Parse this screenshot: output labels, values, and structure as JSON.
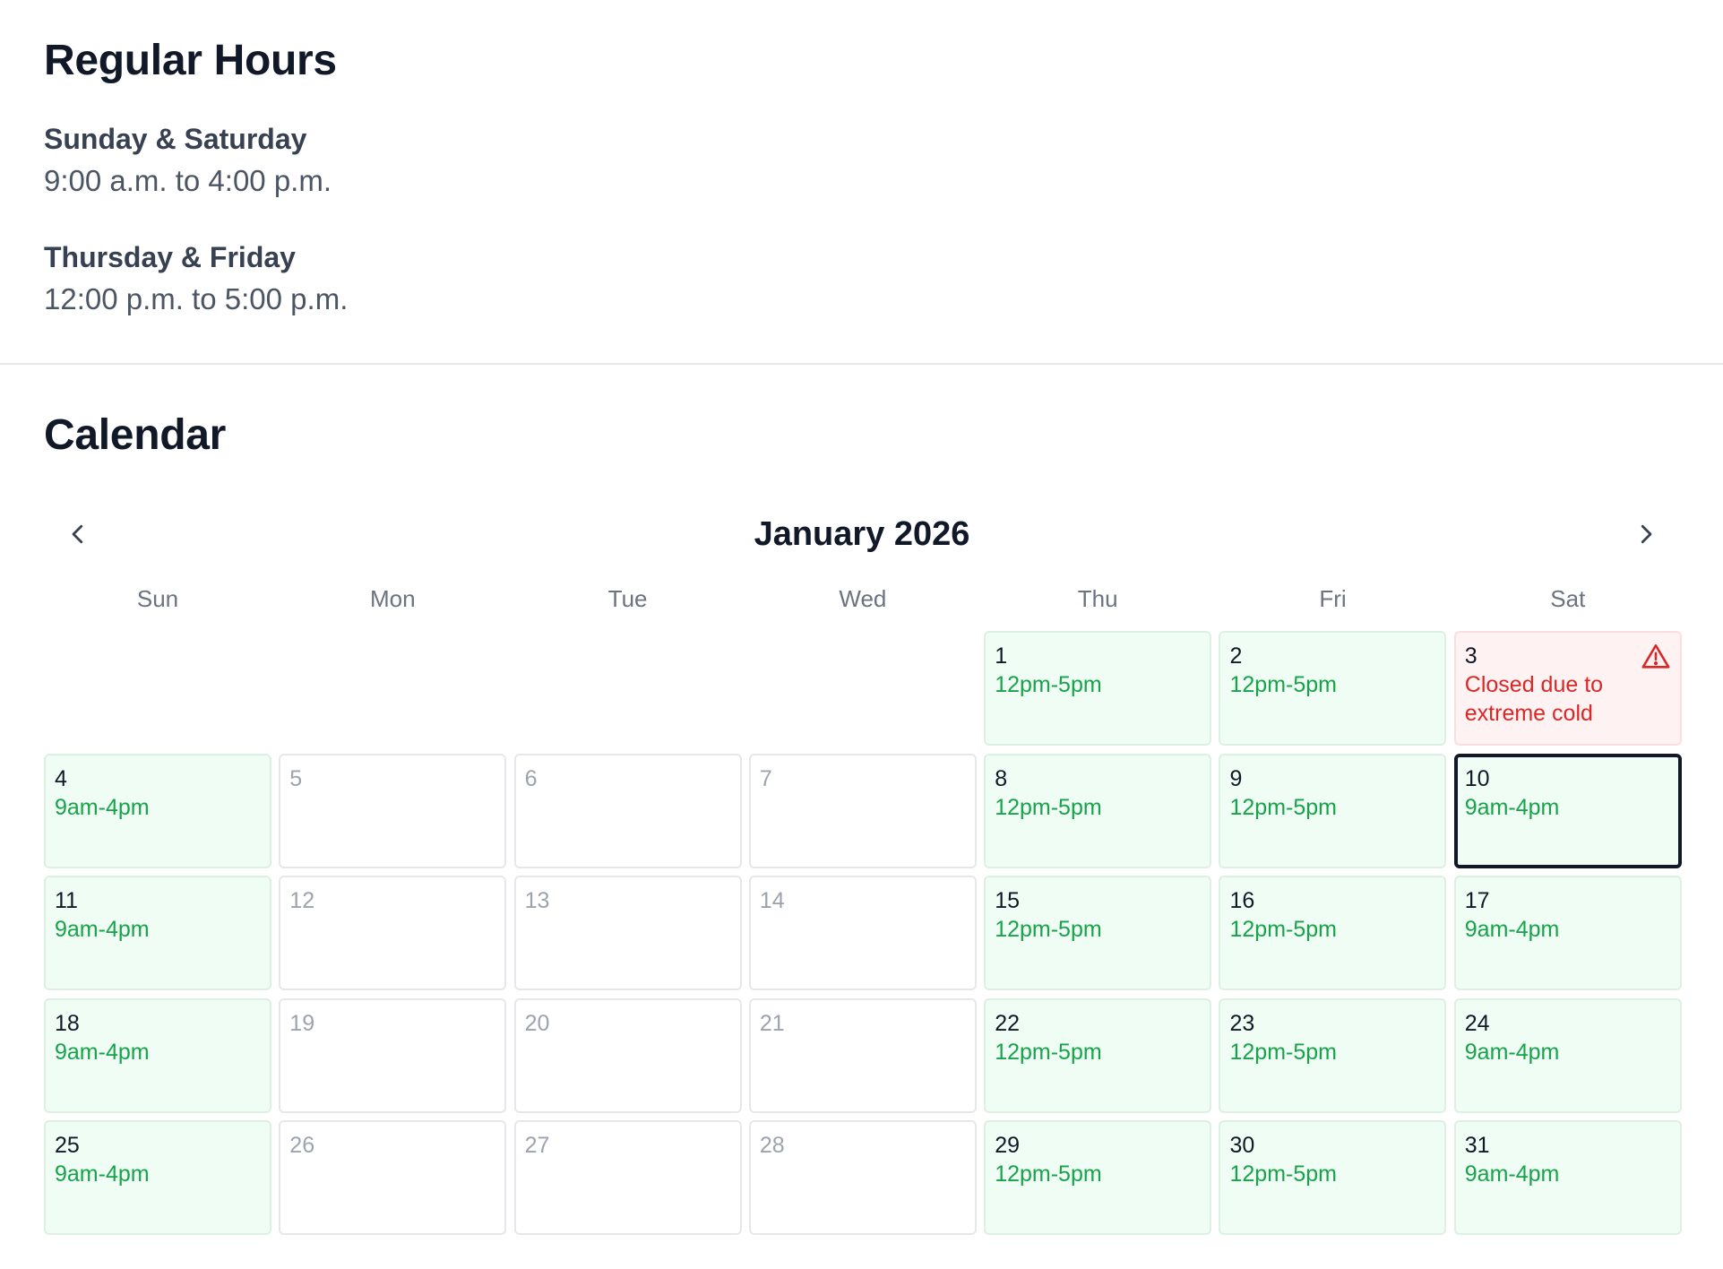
{
  "regular_hours": {
    "title": "Regular Hours",
    "groups": [
      {
        "days": "Sunday & Saturday",
        "time": "9:00 a.m. to 4:00 p.m."
      },
      {
        "days": "Thursday & Friday",
        "time": "12:00 p.m. to 5:00 p.m."
      }
    ]
  },
  "calendar": {
    "title": "Calendar",
    "month_label": "January 2026",
    "prev_icon": "chevron-left-icon",
    "next_icon": "chevron-right-icon",
    "weekdays": [
      "Sun",
      "Mon",
      "Tue",
      "Wed",
      "Thu",
      "Fri",
      "Sat"
    ],
    "colors": {
      "open_bg": "#f0fdf4",
      "open_text": "#16a34a",
      "closed_bg": "#fef2f2",
      "closed_text": "#dc2626",
      "selected_border": "#111827",
      "inactive_text": "#9ca3af"
    },
    "leading_empty": 4,
    "selected_day": "10",
    "days": [
      {
        "day": "1",
        "status": "open",
        "hours": "12pm-5pm"
      },
      {
        "day": "2",
        "status": "open",
        "hours": "12pm-5pm"
      },
      {
        "day": "3",
        "status": "closed",
        "hours": "Closed due to extreme cold",
        "icon": "warning-icon"
      },
      {
        "day": "4",
        "status": "open",
        "hours": "9am-4pm"
      },
      {
        "day": "5",
        "status": "inactive",
        "hours": ""
      },
      {
        "day": "6",
        "status": "inactive",
        "hours": ""
      },
      {
        "day": "7",
        "status": "inactive",
        "hours": ""
      },
      {
        "day": "8",
        "status": "open",
        "hours": "12pm-5pm"
      },
      {
        "day": "9",
        "status": "open",
        "hours": "12pm-5pm"
      },
      {
        "day": "10",
        "status": "open",
        "hours": "9am-4pm"
      },
      {
        "day": "11",
        "status": "open",
        "hours": "9am-4pm"
      },
      {
        "day": "12",
        "status": "inactive",
        "hours": ""
      },
      {
        "day": "13",
        "status": "inactive",
        "hours": ""
      },
      {
        "day": "14",
        "status": "inactive",
        "hours": ""
      },
      {
        "day": "15",
        "status": "open",
        "hours": "12pm-5pm"
      },
      {
        "day": "16",
        "status": "open",
        "hours": "12pm-5pm"
      },
      {
        "day": "17",
        "status": "open",
        "hours": "9am-4pm"
      },
      {
        "day": "18",
        "status": "open",
        "hours": "9am-4pm"
      },
      {
        "day": "19",
        "status": "inactive",
        "hours": ""
      },
      {
        "day": "20",
        "status": "inactive",
        "hours": ""
      },
      {
        "day": "21",
        "status": "inactive",
        "hours": ""
      },
      {
        "day": "22",
        "status": "open",
        "hours": "12pm-5pm"
      },
      {
        "day": "23",
        "status": "open",
        "hours": "12pm-5pm"
      },
      {
        "day": "24",
        "status": "open",
        "hours": "9am-4pm"
      },
      {
        "day": "25",
        "status": "open",
        "hours": "9am-4pm"
      },
      {
        "day": "26",
        "status": "inactive",
        "hours": ""
      },
      {
        "day": "27",
        "status": "inactive",
        "hours": ""
      },
      {
        "day": "28",
        "status": "inactive",
        "hours": ""
      },
      {
        "day": "29",
        "status": "open",
        "hours": "12pm-5pm"
      },
      {
        "day": "30",
        "status": "open",
        "hours": "12pm-5pm"
      },
      {
        "day": "31",
        "status": "open",
        "hours": "9am-4pm"
      }
    ]
  }
}
